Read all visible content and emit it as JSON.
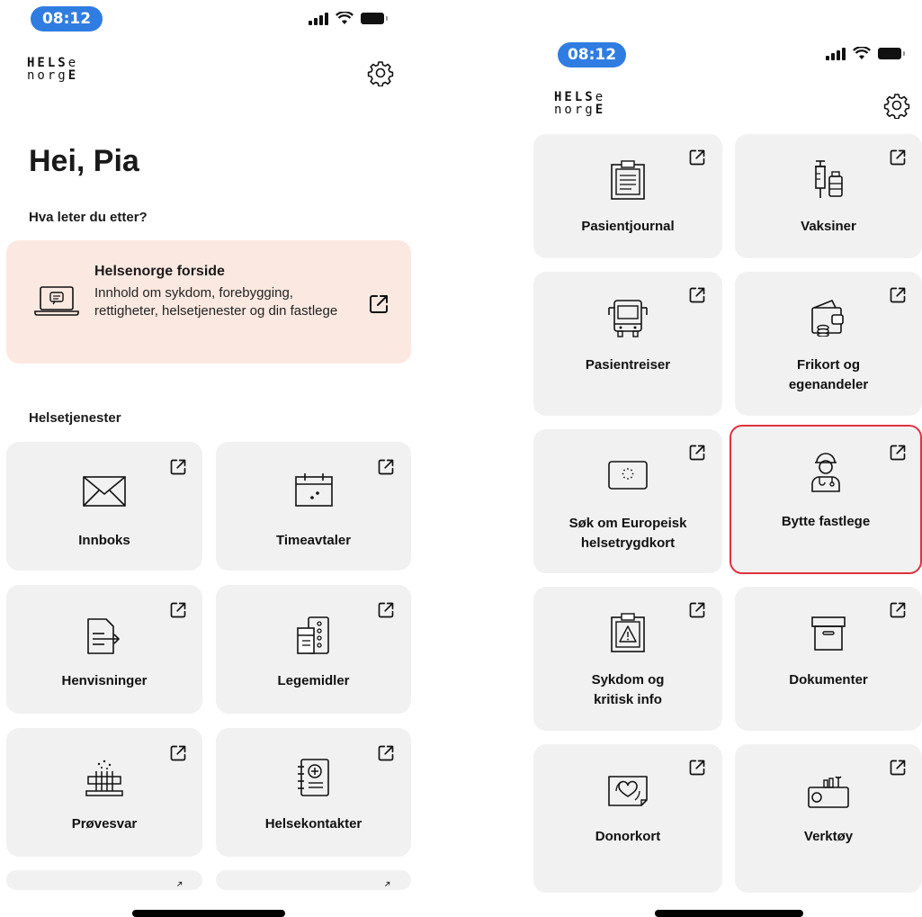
{
  "left": {
    "status_time": "08:12",
    "logo_line1": [
      "HELS",
      "e"
    ],
    "logo_line2": [
      "norg",
      "E"
    ],
    "greeting": "Hei, Pia",
    "question": "Hva leter du etter?",
    "highlight": {
      "title": "Helsenorge forside",
      "description": "Innhold om sykdom, forebygging, rettigheter, helsetjenester og din fastlege"
    },
    "section_title": "Helsetjenester",
    "tiles": [
      {
        "label": "Innboks"
      },
      {
        "label": "Timeavtaler"
      },
      {
        "label": "Henvisninger"
      },
      {
        "label": "Legemidler"
      },
      {
        "label": "Prøvesvar"
      },
      {
        "label": "Helsekontakter"
      }
    ]
  },
  "right": {
    "status_time": "08:12",
    "logo_line1": [
      "HELS",
      "e"
    ],
    "logo_line2": [
      "norg",
      "E"
    ],
    "tiles": [
      {
        "label": "Pasientjournal"
      },
      {
        "label": "Vaksiner"
      },
      {
        "label": "Pasientreiser"
      },
      {
        "label": "Frikort og egenandeler"
      },
      {
        "label": "Søk om Europeisk helsetrygdkort"
      },
      {
        "label": "Bytte fastlege"
      },
      {
        "label": "Sykdom og kritisk info"
      },
      {
        "label": "Dokumenter"
      },
      {
        "label": "Donorkort"
      },
      {
        "label": "Verktøy"
      }
    ]
  },
  "colors": {
    "status_pill": "#2f7de1",
    "highlight_bg": "#fbe9e1",
    "tile_bg": "#f2f1f1",
    "selection_border": "#e0323e"
  }
}
